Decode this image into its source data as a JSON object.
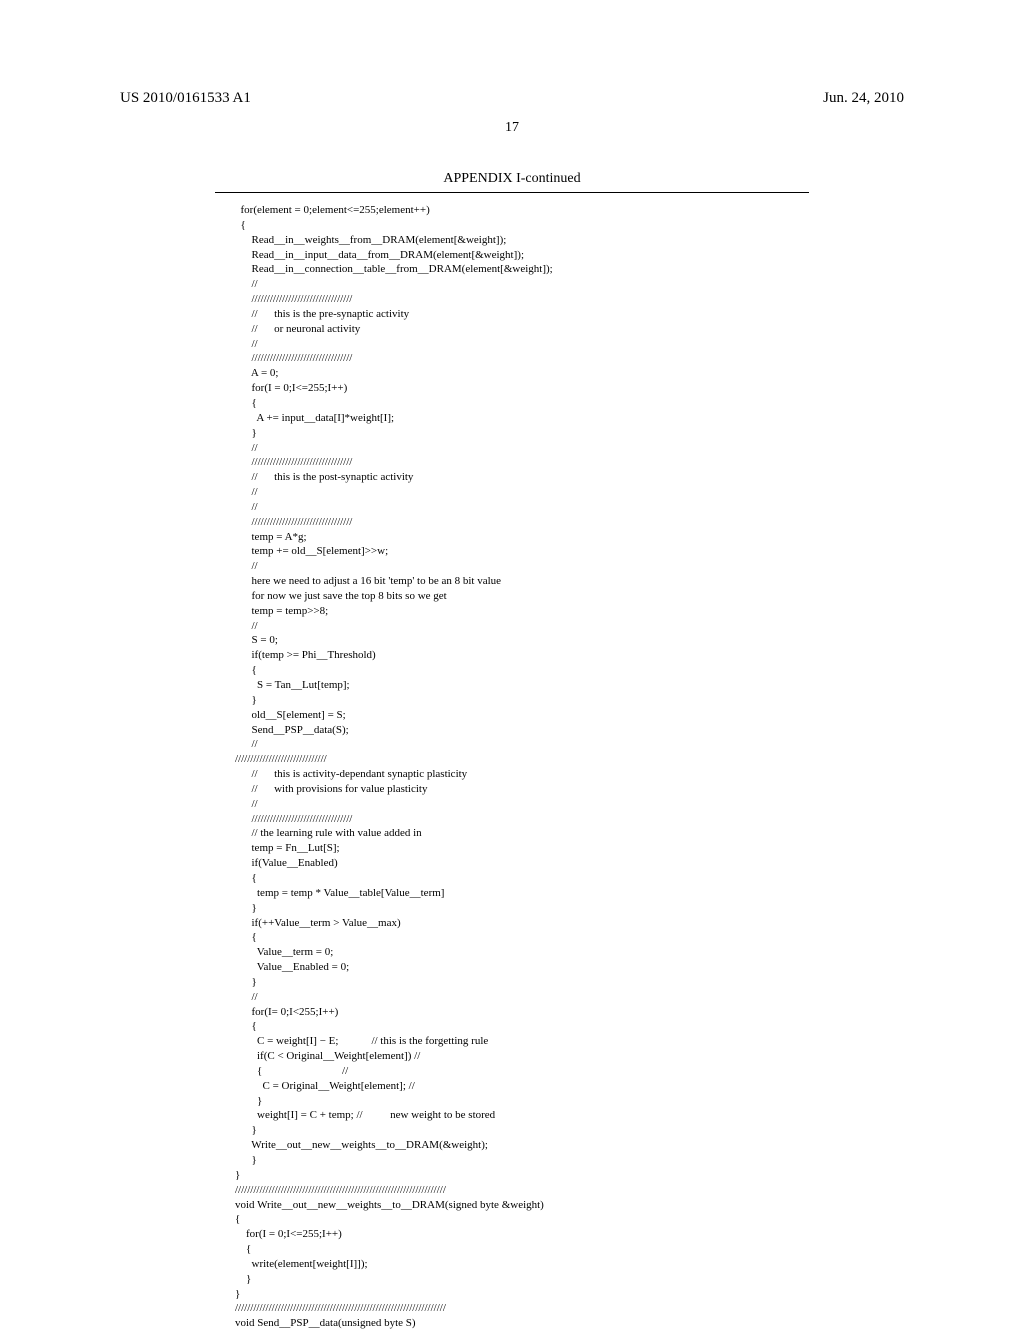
{
  "header": {
    "left": "US 2010/0161533 A1",
    "right": "Jun. 24, 2010",
    "page_number": "17"
  },
  "appendix": {
    "title": "APPENDIX I-continued"
  },
  "code": "  for(element = 0;element<=255;element++)\n  {\n      Read__in__weights__from__DRAM(element[&weight]);\n      Read__in__input__data__from__DRAM(element[&weight]);\n      Read__in__connection__table__from__DRAM(element[&weight]);\n      //\n      /////////////////////////////////\n      //      this is the pre-synaptic activity\n      //      or neuronal activity\n      //\n      /////////////////////////////////\n      A = 0;\n      for(I = 0;I<=255;I++)\n      {\n        A += input__data[I]*weight[I];\n      }\n      //\n      /////////////////////////////////\n      //      this is the post-synaptic activity\n      //\n      //\n      /////////////////////////////////\n      temp = A*g;\n      temp += old__S[element]>>w;\n      //\n      here we need to adjust a 16 bit 'temp' to be an 8 bit value\n      for now we just save the top 8 bits so we get\n      temp = temp>>8;\n      //\n      S = 0;\n      if(temp >= Phi__Threshold)\n      {\n        S = Tan__Lut[temp];\n      }\n      old__S[element] = S;\n      Send__PSP__data(S);\n      //\n//////////////////////////////\n      //      this is activity-dependant synaptic plasticity\n      //      with provisions for value plasticity\n      //\n      /////////////////////////////////\n      // the learning rule with value added in\n      temp = Fn__Lut[S];\n      if(Value__Enabled)\n      {\n        temp = temp * Value__table[Value__term]\n      }\n      if(++Value__term > Value__max)\n      {\n        Value__term = 0;\n        Value__Enabled = 0;\n      }\n      //\n      for(I= 0;I<255;I++)\n      {\n        C = weight[I] − E;            // this is the forgetting rule\n        if(C < Original__Weight[element]) //\n        {                             //\n          C = Original__Weight[element]; //\n        }\n        weight[I] = C + temp; //          new weight to be stored\n      }\n      Write__out__new__weights__to__DRAM(&weight);\n      }\n}\n/////////////////////////////////////////////////////////////////////\nvoid Write__out__new__weights__to__DRAM(signed byte &weight)\n{\n    for(I = 0;I<=255;I++)\n    {\n      write(element[weight[I]]);\n    }\n}\n/////////////////////////////////////////////////////////////////////\nvoid Send__PSP__data(unsigned byte S)"
}
